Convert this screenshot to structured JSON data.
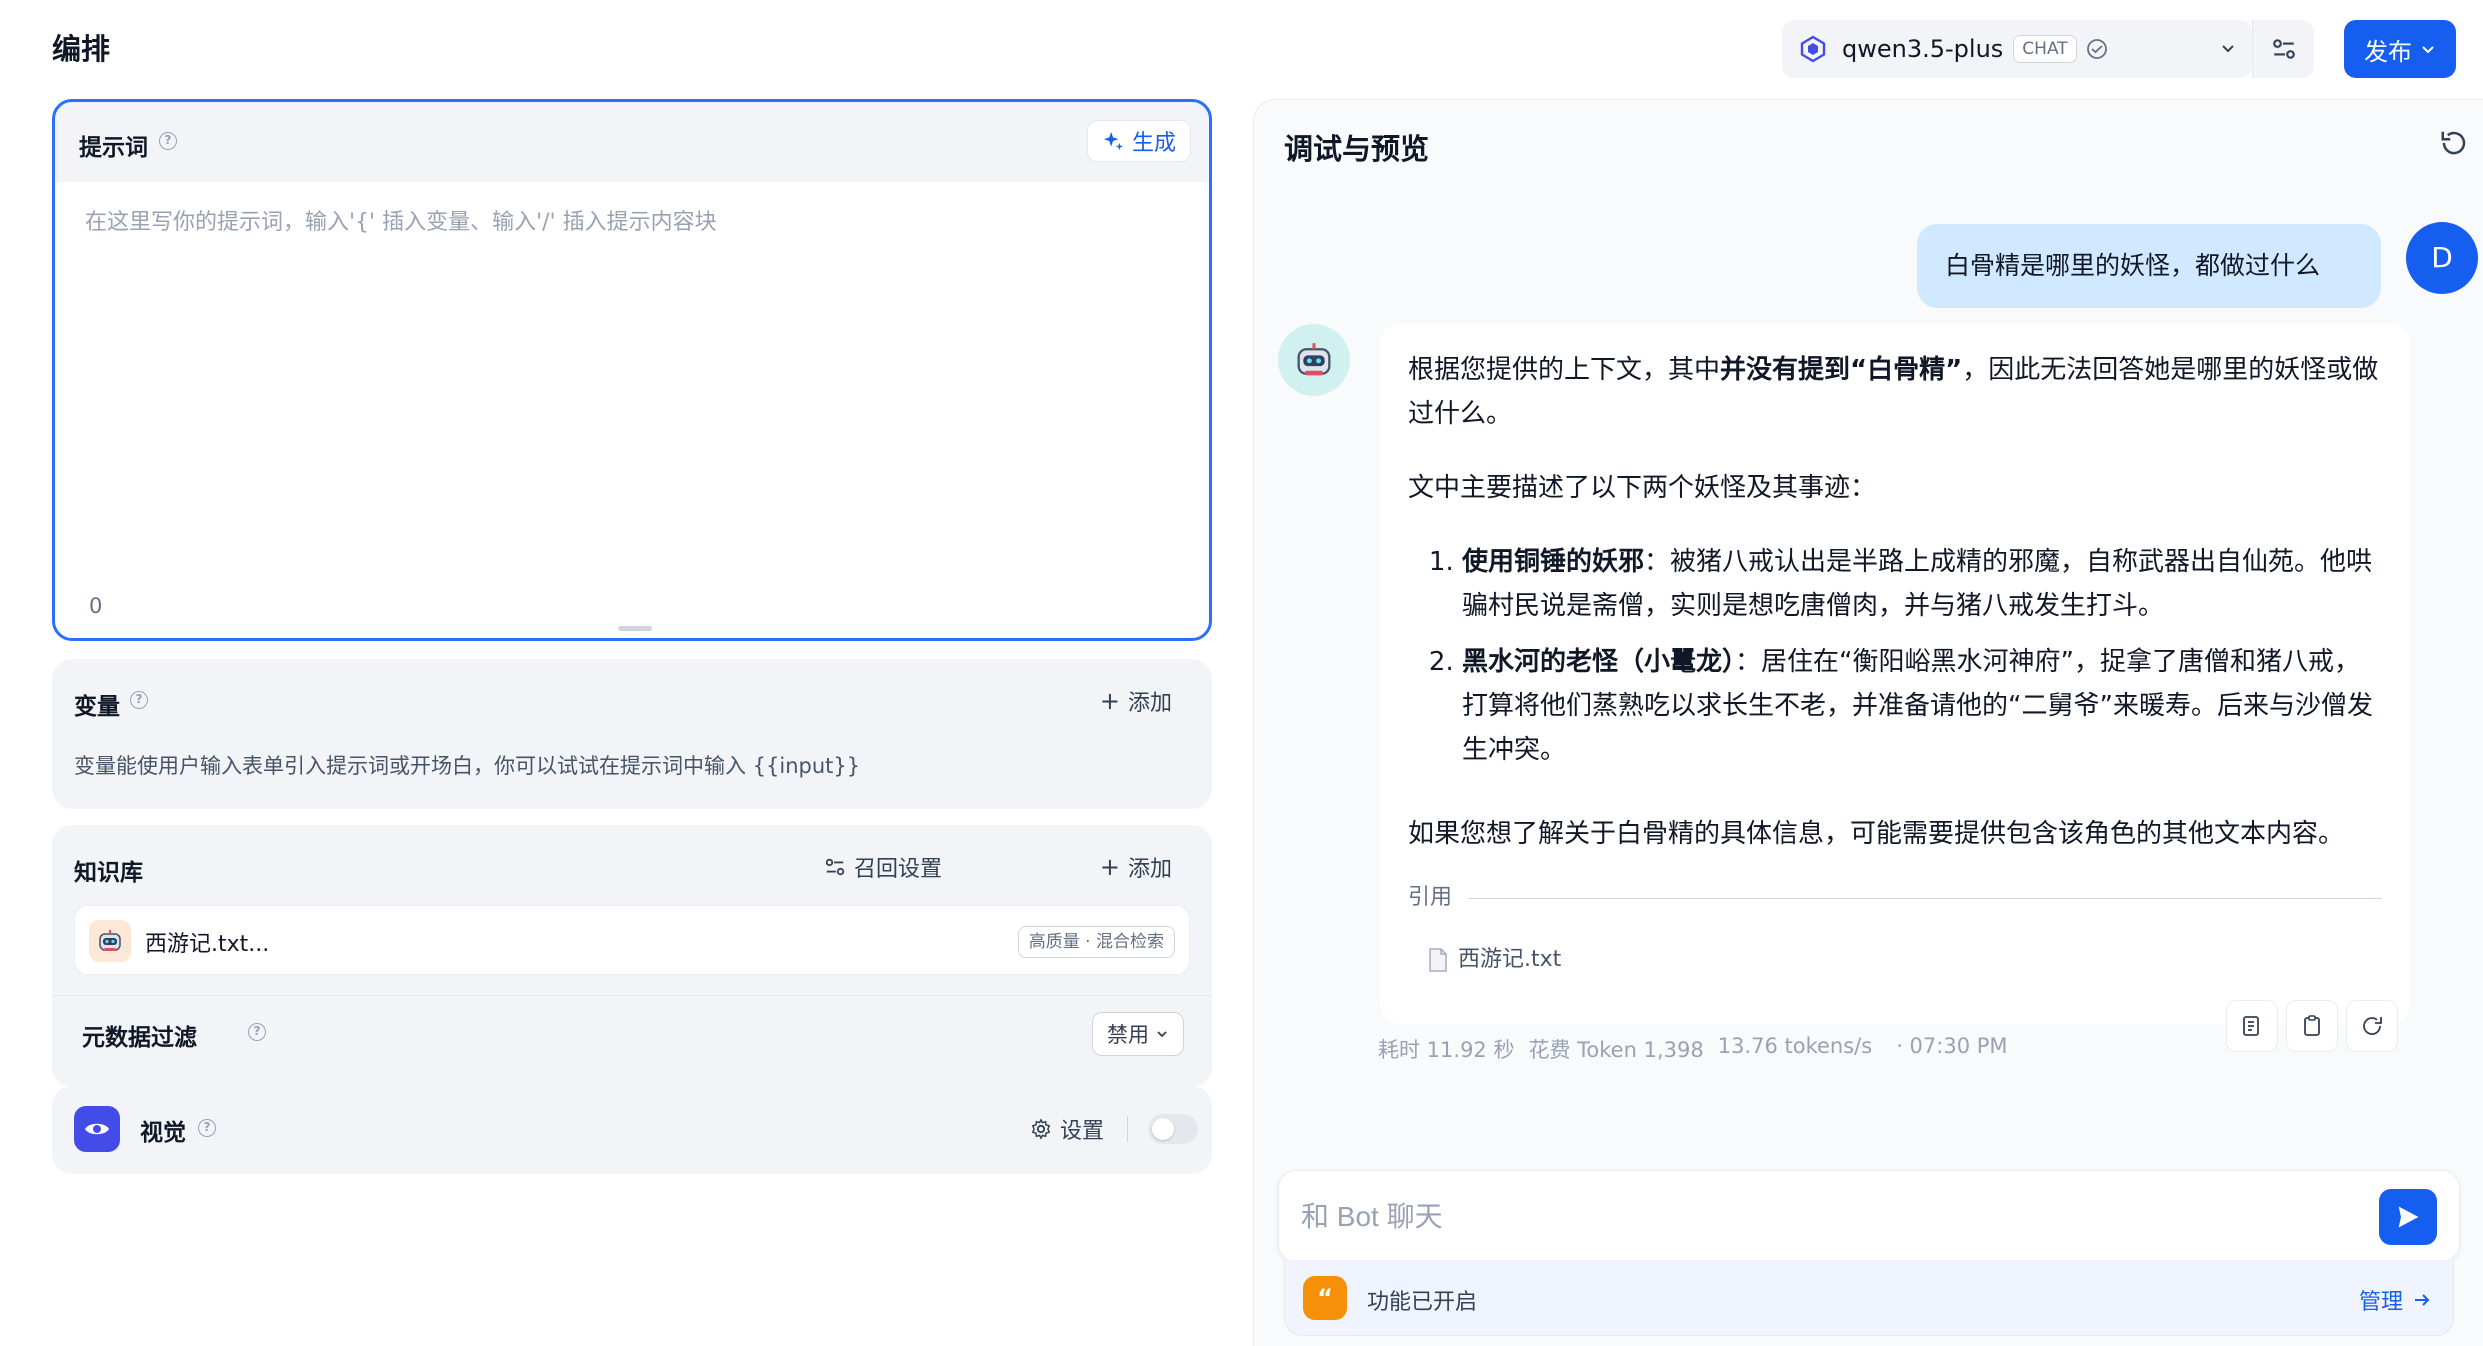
{
  "header": {
    "title": "编排",
    "model_name": "qwen3.5-plus",
    "model_badge": "CHAT",
    "publish_label": "发布"
  },
  "prompt": {
    "title": "提示词",
    "generate_label": "生成",
    "placeholder": "在这里写你的提示词，输入'{' 插入变量、输入'/' 插入提示内容块",
    "char_count": "0"
  },
  "variables": {
    "title": "变量",
    "add_label": "添加",
    "description": "变量能使用户输入表单引入提示词或开场白，你可以试试在提示词中输入 {{input}}"
  },
  "knowledge": {
    "title": "知识库",
    "recall_label": "召回设置",
    "add_label": "添加",
    "file_name": "西游记.txt...",
    "file_badge": "高质量 · 混合检索",
    "metadata_label": "元数据过滤",
    "metadata_value": "禁用"
  },
  "vision": {
    "title": "视觉",
    "settings_label": "设置",
    "enabled": false
  },
  "preview": {
    "title": "调试与预览",
    "user_avatar": "D",
    "user_message": "白骨精是哪里的妖怪，都做过什么",
    "bot": {
      "p1_a": "根据您提供的上下文，其中",
      "p1_b": "并没有提到“白骨精”",
      "p1_c": "，因此无法回答她是哪里的妖怪或做过什么。",
      "p2": "文中主要描述了以下两个妖怪及其事迹：",
      "items": [
        {
          "bold": "使用铜锤的妖邪",
          "text": "：被猪八戒认出是半路上成精的邪魔，自称武器出自仙苑。他哄骗村民说是斋僧，实则是想吃唐僧肉，并与猪八戒发生打斗。"
        },
        {
          "bold": "黑水河的老怪（小鼍龙）",
          "text": "：居住在“衡阳峪黑水河神府”，捉拿了唐僧和猪八戒，打算将他们蒸熟吃以求长生不老，并准备请他的“二舅爷”来暖寿。后来与沙僧发生冲突。"
        }
      ],
      "p3": "如果您想了解关于白骨精的具体信息，可能需要提供包含该角色的其他文本内容。",
      "citation_label": "引用",
      "citation_file": "西游记.txt"
    },
    "stats": {
      "time": "耗时 11.92 秒",
      "tokens": "花费 Token 1,398",
      "speed": "13.76 tokens/s",
      "timestamp": "· 07:30 PM"
    },
    "input_placeholder": "和 Bot 聊天",
    "features_label": "功能已开启",
    "manage_label": "管理"
  },
  "colors": {
    "accent": "#155eef",
    "panel": "#f2f4f7",
    "user_bubble": "#d1e9ff",
    "vision_icon": "#444ce7",
    "features_icon": "#f79009"
  },
  "icons": {
    "generate": "sparkle-icon",
    "help": "help-circle-icon",
    "model": "model-provider-icon",
    "refresh": "refresh-icon",
    "send": "send-icon",
    "settings": "gear-icon",
    "vision": "eye-icon",
    "recall": "sliders-icon"
  }
}
